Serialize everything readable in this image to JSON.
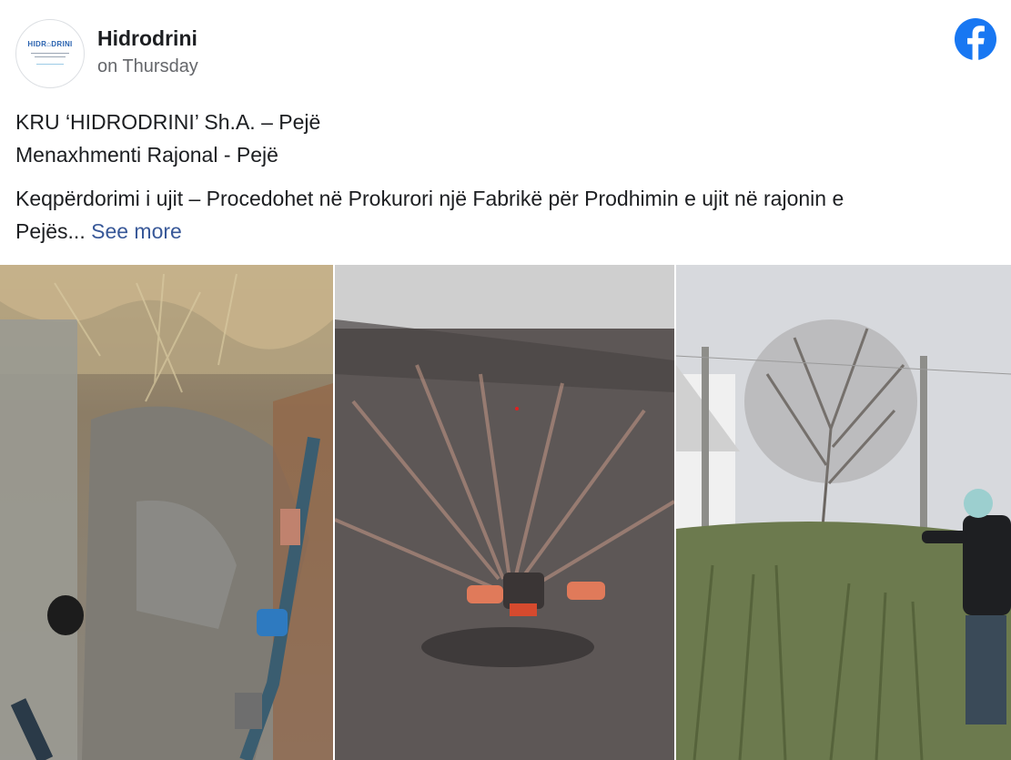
{
  "post": {
    "page_name": "Hidrodrini",
    "time": "on Thursday",
    "avatar_logo_text": "HIDR⌂DRINI",
    "lines": [
      "KRU ‘HIDRODRINI’ Sh.A. – Pejë",
      "Menaxhmenti Rajonal - Pejë",
      "Keqpërdorimi i ujit – Procedohet në Prokurori një Fabrikë për Prodhimin e ujit në rajonin e",
      "Pejës..."
    ],
    "see_more": "See more"
  },
  "icons": {
    "brand": "facebook-icon"
  },
  "colors": {
    "facebook_blue": "#1877f2",
    "link": "#385898",
    "secondary_text": "#65676b"
  }
}
